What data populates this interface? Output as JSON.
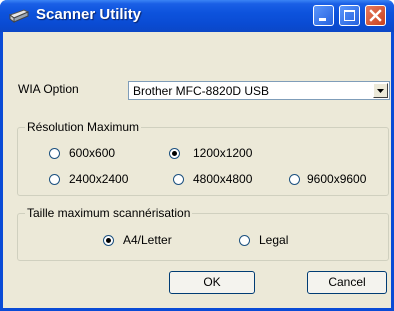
{
  "window": {
    "title": "Scanner Utility"
  },
  "wia": {
    "label": "WIA Option",
    "selected": "Brother MFC-8820D USB"
  },
  "resolution": {
    "title": "Résolution Maximum",
    "options": [
      "600x600",
      "1200x1200",
      "2400x2400",
      "4800x4800",
      "9600x9600"
    ],
    "selected": "1200x1200"
  },
  "size": {
    "title": "Taille maximum scannérisation",
    "options": [
      "A4/Letter",
      "Legal"
    ],
    "selected": "A4/Letter"
  },
  "buttons": {
    "ok": "OK",
    "cancel": "Cancel"
  },
  "icons": {
    "app": "scanner-icon",
    "minimize": "minimize-icon",
    "maximize": "maximize-icon",
    "close": "close-icon",
    "dropdown": "chevron-down-icon"
  }
}
